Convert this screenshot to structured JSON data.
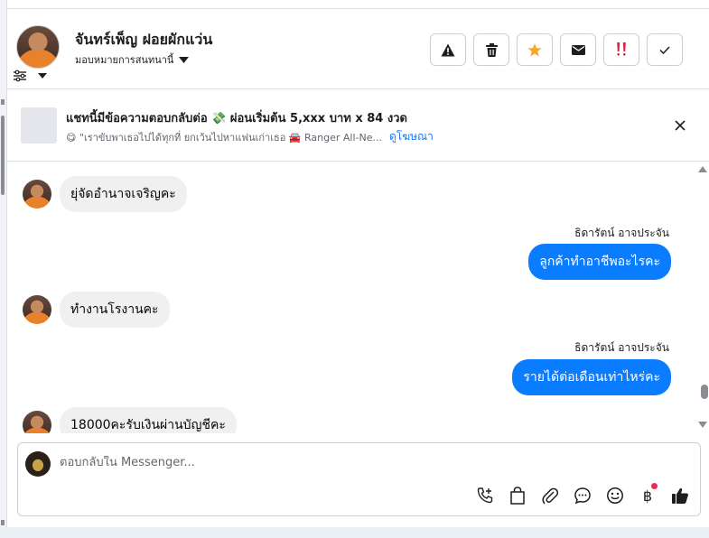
{
  "header": {
    "contact_name": "จันทร์เพ็ญ ฝอยผักแว่น",
    "assign_label": "มอบหมายการสนทนานี้",
    "actions": [
      {
        "icon": "warning-icon",
        "label": "report"
      },
      {
        "icon": "trash-icon",
        "label": "delete"
      },
      {
        "icon": "star-icon",
        "label": "star"
      },
      {
        "icon": "envelope-icon",
        "label": "mark unread"
      },
      {
        "icon": "urgent-icon",
        "label": "urgent"
      },
      {
        "icon": "check-icon",
        "label": "done"
      }
    ]
  },
  "ad": {
    "title": "แชทนี้มีข้อความตอบกลับต่อ 💸 ผ่อนเริ่มต้น 5,xxx บาท x 84 งวด",
    "subtitle": "😋 \"เราขับพาเธอไปได้ทุกที่ ยกเว้นไปหาแฟนเก่าเธอ 🚘 Ranger All-Ne...",
    "link": "ดูโฆษณา"
  },
  "messages": [
    {
      "direction": "in",
      "text": "ยุ่จัดอำนาจเจริญคะ"
    },
    {
      "direction": "out",
      "sender": "ธิดารัตน์ อาจประจัน",
      "text": "ลูกค้าทำอาชีพอะไรคะ"
    },
    {
      "direction": "in",
      "text": "ทำงานโรงานคะ"
    },
    {
      "direction": "out",
      "sender": "ธิดารัตน์ อาจประจัน",
      "text": "รายได้ต่อเดือนเท่าไหร่คะ"
    },
    {
      "direction": "in",
      "text": "18000คะรับเงินผ่านบัญชีคะ"
    }
  ],
  "composer": {
    "placeholder": "ตอบกลับใน Messenger...",
    "tools": [
      "phone-add-icon",
      "bag-icon",
      "paperclip-icon",
      "chat-icon",
      "emoji-icon",
      "baht-icon",
      "thumbs-up-icon"
    ],
    "baht_symbol": "฿"
  },
  "colors": {
    "accent": "#0a7cff",
    "star": "#f5a623",
    "urgent": "#e41e3f",
    "notification_dot": "#f02849"
  }
}
